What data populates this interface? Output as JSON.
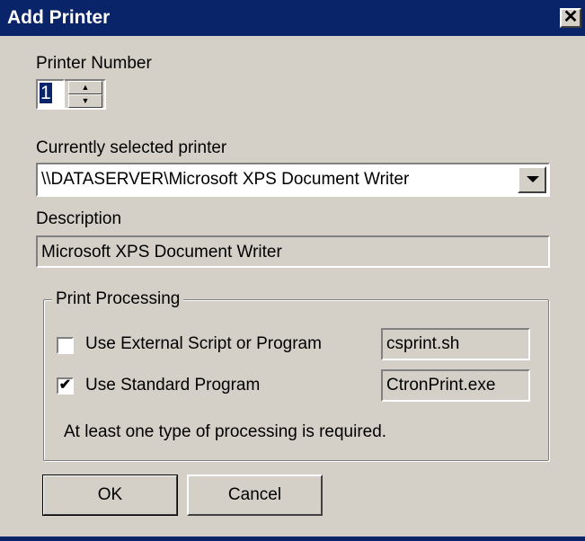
{
  "window": {
    "title": "Add Printer",
    "close_label": "✕"
  },
  "printer_number": {
    "label": "Printer Number",
    "value": "1",
    "up_glyph": "▲",
    "down_glyph": "▼"
  },
  "selected_printer": {
    "label": "Currently selected printer",
    "value": "\\\\DATASERVER\\Microsoft XPS Document Writer"
  },
  "description": {
    "label": "Description",
    "value": "Microsoft XPS Document Writer"
  },
  "print_processing": {
    "group_title": "Print Processing",
    "external": {
      "label": "Use External Script or Program",
      "checked": false,
      "value": "csprint.sh"
    },
    "standard": {
      "label": "Use Standard Program",
      "checked": true,
      "check_glyph": "✔",
      "value": "CtronPrint.exe"
    },
    "note": "At least one type of processing is required."
  },
  "buttons": {
    "ok": "OK",
    "cancel": "Cancel"
  },
  "colors": {
    "titlebar": "#0a246a",
    "dialog_face": "#d4d0c8"
  }
}
